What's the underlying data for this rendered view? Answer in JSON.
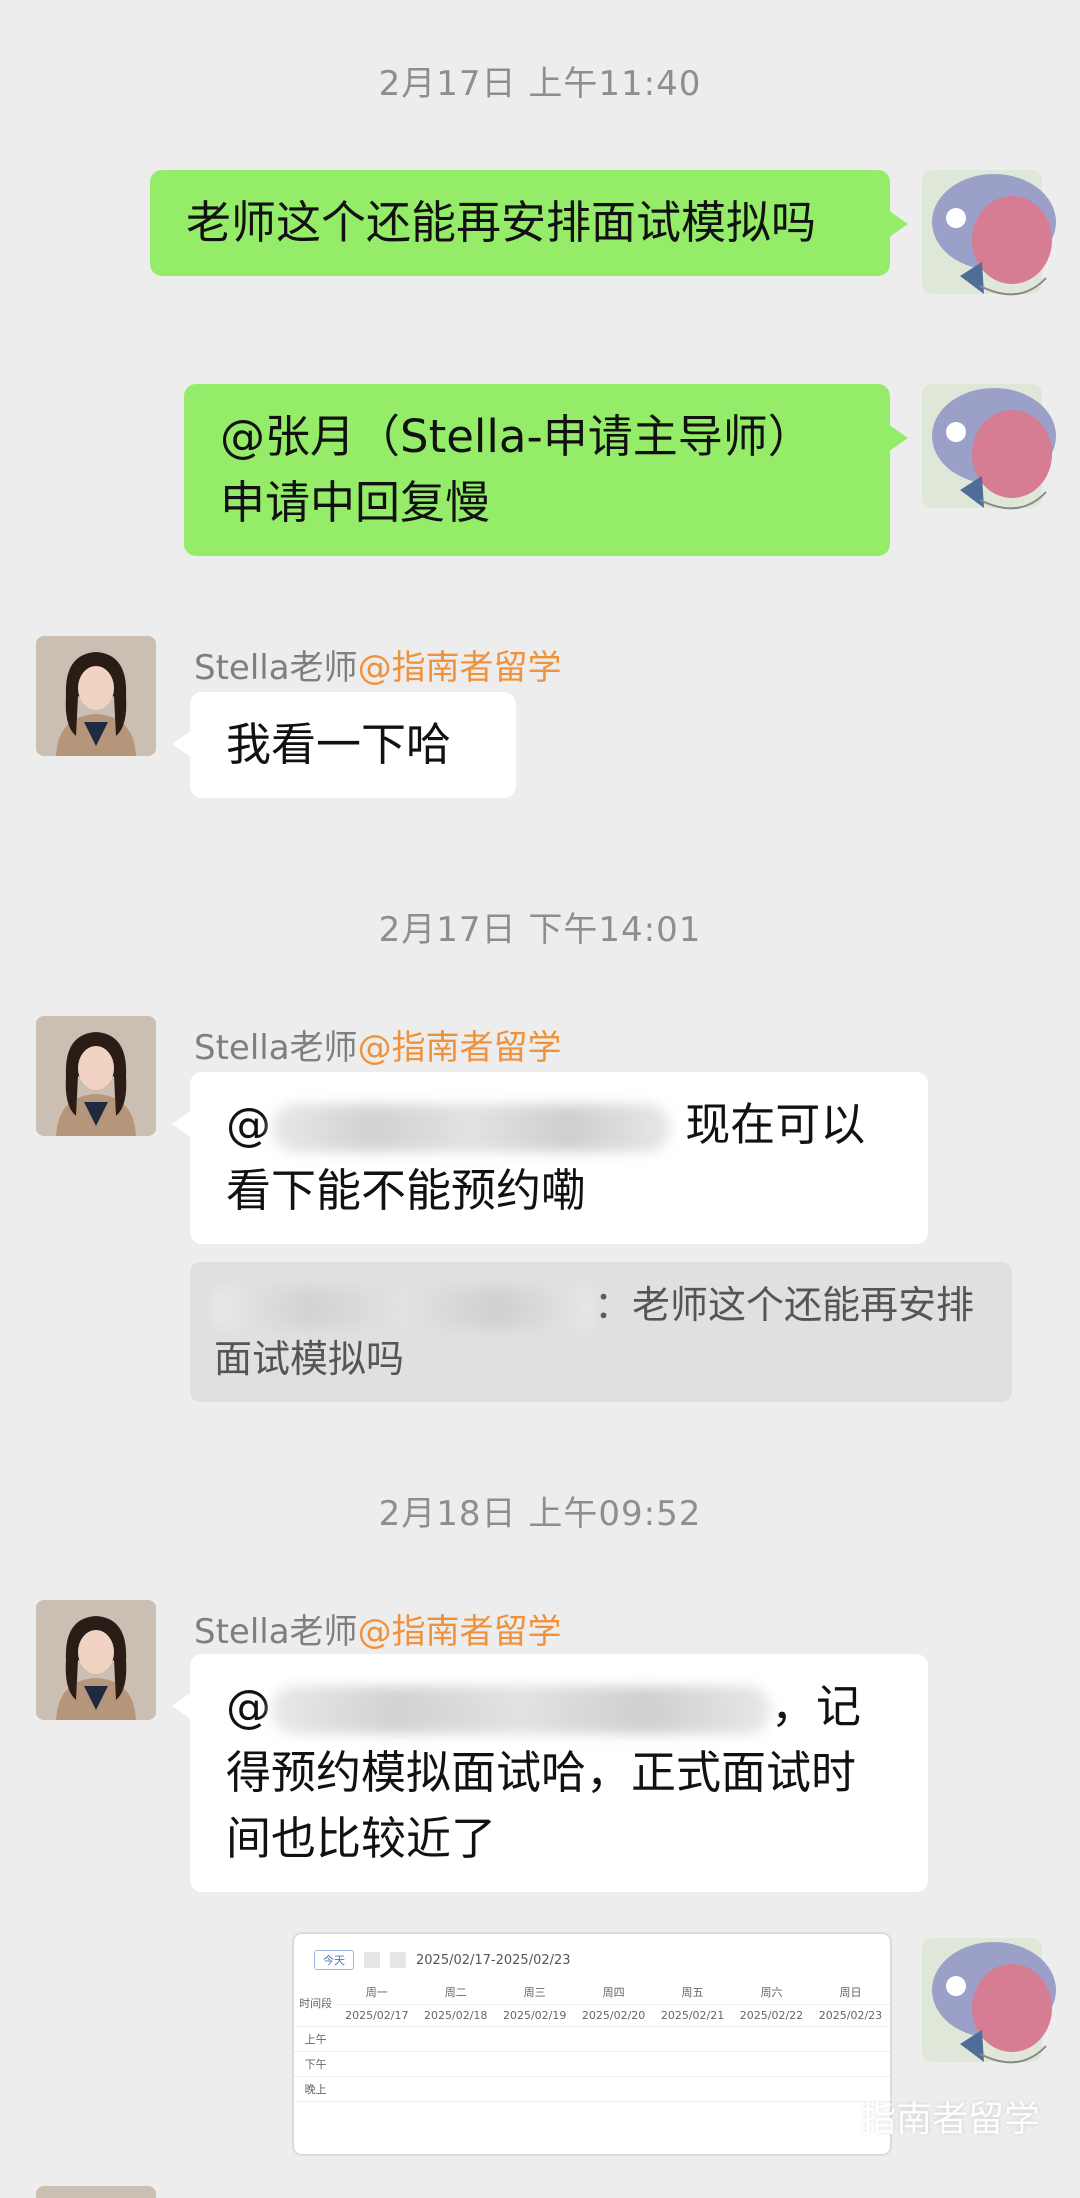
{
  "timestamps": [
    "2月17日 上午11:40",
    "2月17日 下午14:01",
    "2月18日 上午09:52"
  ],
  "messages": {
    "m1": "老师这个还能再安排面试模拟吗",
    "m2": "@张月（Stella-申请主导师）申请中回复慢",
    "m3": "我看一下哈",
    "m4_prefix": "@",
    "m4_after": " 现在可以看下能不能预约嘞",
    "m5_prefix": "@",
    "m5_after": "，记得预约模拟面试哈，正式面试时间也比较近了"
  },
  "sender": {
    "name": "Stella老师",
    "org": "@指南者留学"
  },
  "quote": {
    "text": "：老师这个还能再安排面试模拟吗"
  },
  "schedule": {
    "today_btn": "今天",
    "range": "2025/02/17-2025/02/23",
    "period_header": "时间段",
    "days": [
      {
        "wd": "周一",
        "date": "2025/02/17"
      },
      {
        "wd": "周二",
        "date": "2025/02/18"
      },
      {
        "wd": "周三",
        "date": "2025/02/19"
      },
      {
        "wd": "周四",
        "date": "2025/02/20"
      },
      {
        "wd": "周五",
        "date": "2025/02/21"
      },
      {
        "wd": "周六",
        "date": "2025/02/22"
      },
      {
        "wd": "周日",
        "date": "2025/02/23"
      }
    ],
    "periods": [
      "上午",
      "下午",
      "晚上"
    ]
  },
  "watermark": "指南者留学",
  "colors": {
    "self_bubble": "#95ec69",
    "org_text": "#f0923a",
    "background": "#ededed"
  }
}
